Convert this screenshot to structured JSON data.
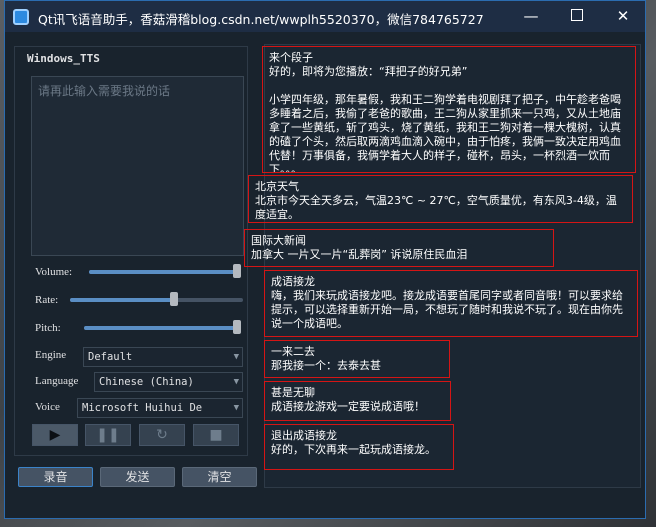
{
  "window": {
    "title": "Qt讯飞语音助手，香菇滑稽blog.csdn.net/wwplh5520370，微信784765727",
    "controls": {
      "minimize": "—",
      "close": "✕"
    }
  },
  "tts_panel": {
    "group_title": "Windows_TTS",
    "input_placeholder": "请再此输入需要我说的话",
    "volume": {
      "label": "Volume:",
      "value": 1.0
    },
    "rate": {
      "label": "Rate:",
      "value": 0.6
    },
    "pitch": {
      "label": "Pitch:",
      "value": 1.0
    },
    "engine": {
      "label": "Engine",
      "value": "Default"
    },
    "language": {
      "label": "Language",
      "value": "Chinese (China)"
    },
    "voice": {
      "label": "Voice",
      "value": "Microsoft Huihui De"
    },
    "playback": [
      {
        "name": "play",
        "glyph": "▶",
        "enabled": true
      },
      {
        "name": "pause",
        "glyph": "❚❚",
        "enabled": false
      },
      {
        "name": "resume",
        "glyph": "↻",
        "enabled": false
      },
      {
        "name": "stop",
        "glyph": "■",
        "enabled": false
      }
    ]
  },
  "buttons": {
    "record": "录音",
    "send": "发送",
    "clear": "清空"
  },
  "messages": [
    {
      "title": "来个段子",
      "body": "好的，即将为您播放：“拜把子的好兄弟”\n\n小学四年级，那年暑假，我和王二狗学着电视剧拜了把子，中午趁老爸喝多睡着之后，我偷了老爸的歌曲，王二狗从家里抓来一只鸡，又从土地庙拿了一些黄纸，斩了鸡头，烧了黄纸，我和王二狗对着一棵大槐树，认真的磕了个头，然后取两滴鸡血滴入碗中，由于怕疼，我俩一致决定用鸡血代替！万事俱备，我俩学着大人的样子，碰杯，昂头，一杯烈酒一饮而下。。。"
    },
    {
      "title": "北京天气",
      "body": "北京市今天全天多云，气温23℃ ~ 27℃，空气质量优，有东风3-4级，温度适宜。"
    },
    {
      "title": "国际大新闻",
      "body": "加拿大 一片又一片“乱葬岗” 诉说原住民血泪"
    },
    {
      "title": "成语接龙",
      "body": "嗨，我们来玩成语接龙吧。接龙成语要首尾同字或者同音哦！可以要求给提示，可以选择重新开始一局，不想玩了随时和我说不玩了。现在由你先说一个成语吧。"
    },
    {
      "title": "一来二去",
      "body": "那我接一个：去泰去甚"
    },
    {
      "title": "甚是无聊",
      "body": "成语接龙游戏一定要说成语哦！"
    },
    {
      "title": "退出成语接龙",
      "body": "好的，下次再来一起玩成语接龙。"
    }
  ]
}
